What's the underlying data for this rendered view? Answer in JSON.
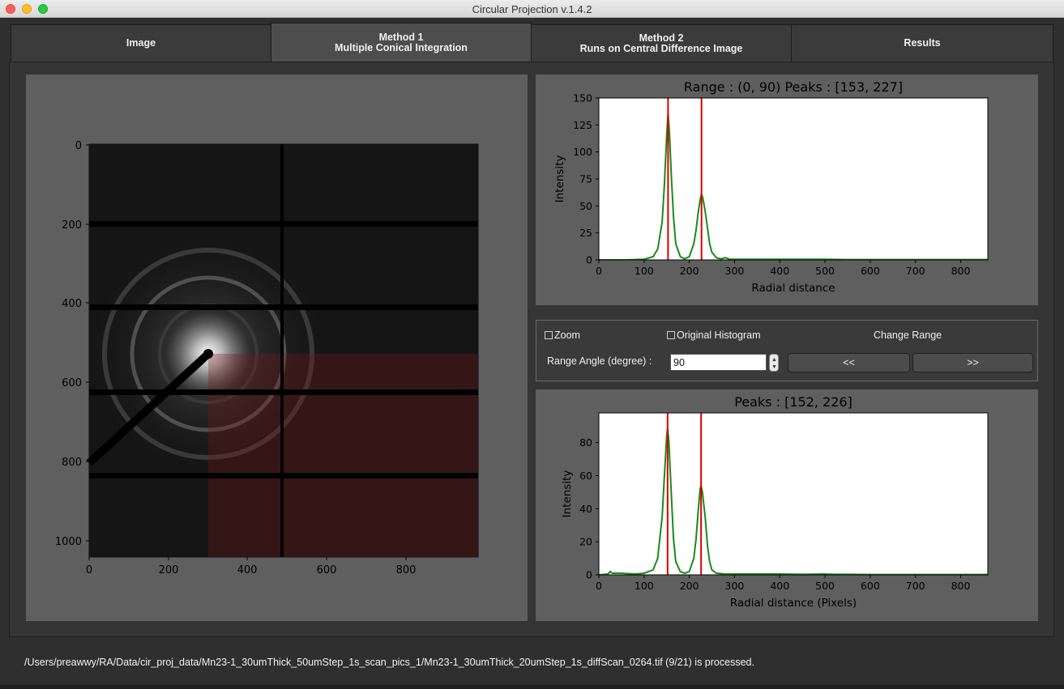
{
  "window": {
    "title": "Circular Projection v.1.4.2"
  },
  "tabs": [
    {
      "line1": "Image",
      "line2": ""
    },
    {
      "line1": "Method 1",
      "line2": "Multiple Conical Integration"
    },
    {
      "line1": "Method 2",
      "line2": "Runs on Central Difference Image"
    },
    {
      "line1": "Results",
      "line2": ""
    }
  ],
  "active_tab": "Method 1",
  "image_axes": {
    "x_ticks": [
      "0",
      "200",
      "400",
      "600",
      "800"
    ],
    "y_ticks": [
      "0",
      "200",
      "400",
      "600",
      "800",
      "1000"
    ]
  },
  "controls": {
    "zoom_label": "Zoom",
    "zoom_checked": false,
    "original_histogram_label": "Original Histogram",
    "original_histogram_checked": false,
    "change_range_label": "Change Range",
    "range_angle_label": "Range Angle (degree) :",
    "range_angle_value": "90",
    "prev_label": "<<",
    "next_label": ">>"
  },
  "status": "/Users/preawwy/RA/Data/cir_proj_data/Mn23-1_30umThick_50umStep_1s_scan_pics_1/Mn23-1_30umThick_20umStep_1s_diffScan_0264.tif (9/21) is processed.",
  "colors": {
    "curve": "#1a8a1a",
    "peak_line": "#dd0000"
  },
  "chart_data": [
    {
      "type": "line",
      "title": "Range : (0, 90)   Peaks : [153, 227]",
      "xlabel": "Radial distance",
      "ylabel": "Intensity",
      "xlim": [
        0,
        860
      ],
      "ylim": [
        0,
        150
      ],
      "x_ticks": [
        0,
        100,
        200,
        300,
        400,
        500,
        600,
        700,
        800
      ],
      "y_ticks": [
        0,
        25,
        50,
        75,
        100,
        125,
        150
      ],
      "peaks": [
        153,
        227
      ],
      "series": [
        {
          "x": [
            0,
            60,
            100,
            120,
            130,
            140,
            145,
            150,
            153,
            156,
            160,
            165,
            170,
            180,
            190,
            200,
            210,
            215,
            220,
            225,
            227,
            230,
            235,
            240,
            245,
            250,
            260,
            270,
            280,
            290,
            300,
            350,
            400,
            450,
            500,
            550,
            600,
            700,
            800,
            860
          ],
          "y": [
            0,
            0,
            0.5,
            3,
            10,
            35,
            70,
            115,
            136,
            118,
            80,
            40,
            15,
            3,
            1,
            3,
            15,
            28,
            45,
            58,
            61,
            57,
            45,
            30,
            15,
            7,
            2,
            1,
            2,
            0.5,
            0.5,
            0.5,
            0.5,
            0.5,
            0.5,
            0.3,
            0.3,
            0.3,
            0.3,
            0.3
          ]
        }
      ]
    },
    {
      "type": "line",
      "title": "Peaks : [152, 226]",
      "xlabel": "Radial distance (Pixels)",
      "ylabel": "Intensity",
      "xlim": [
        0,
        860
      ],
      "ylim": [
        0,
        98
      ],
      "x_ticks": [
        0,
        100,
        200,
        300,
        400,
        500,
        600,
        700,
        800
      ],
      "y_ticks": [
        0,
        20,
        40,
        60,
        80
      ],
      "peaks": [
        152,
        226
      ],
      "series": [
        {
          "x": [
            0,
            20,
            25,
            30,
            50,
            80,
            100,
            120,
            130,
            140,
            145,
            150,
            152,
            155,
            160,
            165,
            170,
            180,
            190,
            200,
            210,
            215,
            220,
            224,
            226,
            229,
            235,
            240,
            245,
            250,
            260,
            280,
            300,
            350,
            400,
            450,
            500,
            520,
            550,
            600,
            700,
            800,
            860
          ],
          "y": [
            0,
            0.5,
            2,
            1,
            1,
            0.5,
            1,
            3,
            10,
            35,
            60,
            84,
            89,
            80,
            50,
            22,
            8,
            2,
            1,
            2,
            10,
            22,
            40,
            52,
            54,
            50,
            35,
            18,
            8,
            3,
            1,
            0.5,
            0.5,
            0.5,
            0.5,
            0.3,
            0.5,
            0.3,
            0.3,
            0.2,
            0.2,
            0.2,
            0.2
          ]
        }
      ]
    }
  ]
}
